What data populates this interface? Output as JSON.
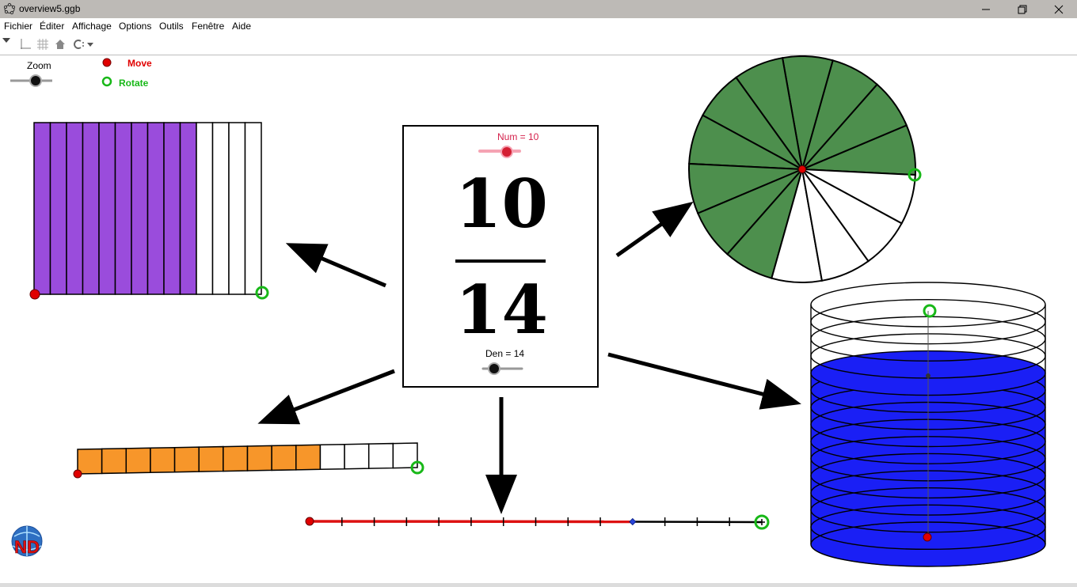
{
  "window": {
    "title": "overview5.ggb",
    "icons": [
      "geogebra-app-icon",
      "minimize-icon",
      "restore-icon",
      "close-icon"
    ]
  },
  "menubar": {
    "items": [
      "Fichier",
      "Éditer",
      "Affichage",
      "Options",
      "Outils",
      "Fenêtre",
      "Aide"
    ]
  },
  "toolbar": {
    "icons": [
      "perspective-dropdown-icon",
      "axes-toggle-icon",
      "grid-toggle-icon",
      "home-icon",
      "point-capture-dropdown-icon"
    ]
  },
  "controls": {
    "zoom_label": "Zoom",
    "zoom_value": 0.5,
    "move_legend": "Move",
    "rotate_legend": "Rotate",
    "move_color": "#e00000",
    "rotate_color": "#18b818"
  },
  "fraction": {
    "numerator": 10,
    "denominator": 14,
    "numerator_text": "10",
    "denominator_text": "14",
    "num_slider_label": "Num = 10",
    "den_slider_label": "Den = 14",
    "num_label_color": "#d41f4a",
    "num_slider_color": "#f5a3b3"
  },
  "representations": {
    "area_model_color": "#9a4cdc",
    "strip_color": "#f7962a",
    "circle_color": "#4d8f4d",
    "number_line_color": "#dd1111",
    "cylinder_color": "#1a1ff5"
  },
  "logo": {
    "text": "ND"
  }
}
